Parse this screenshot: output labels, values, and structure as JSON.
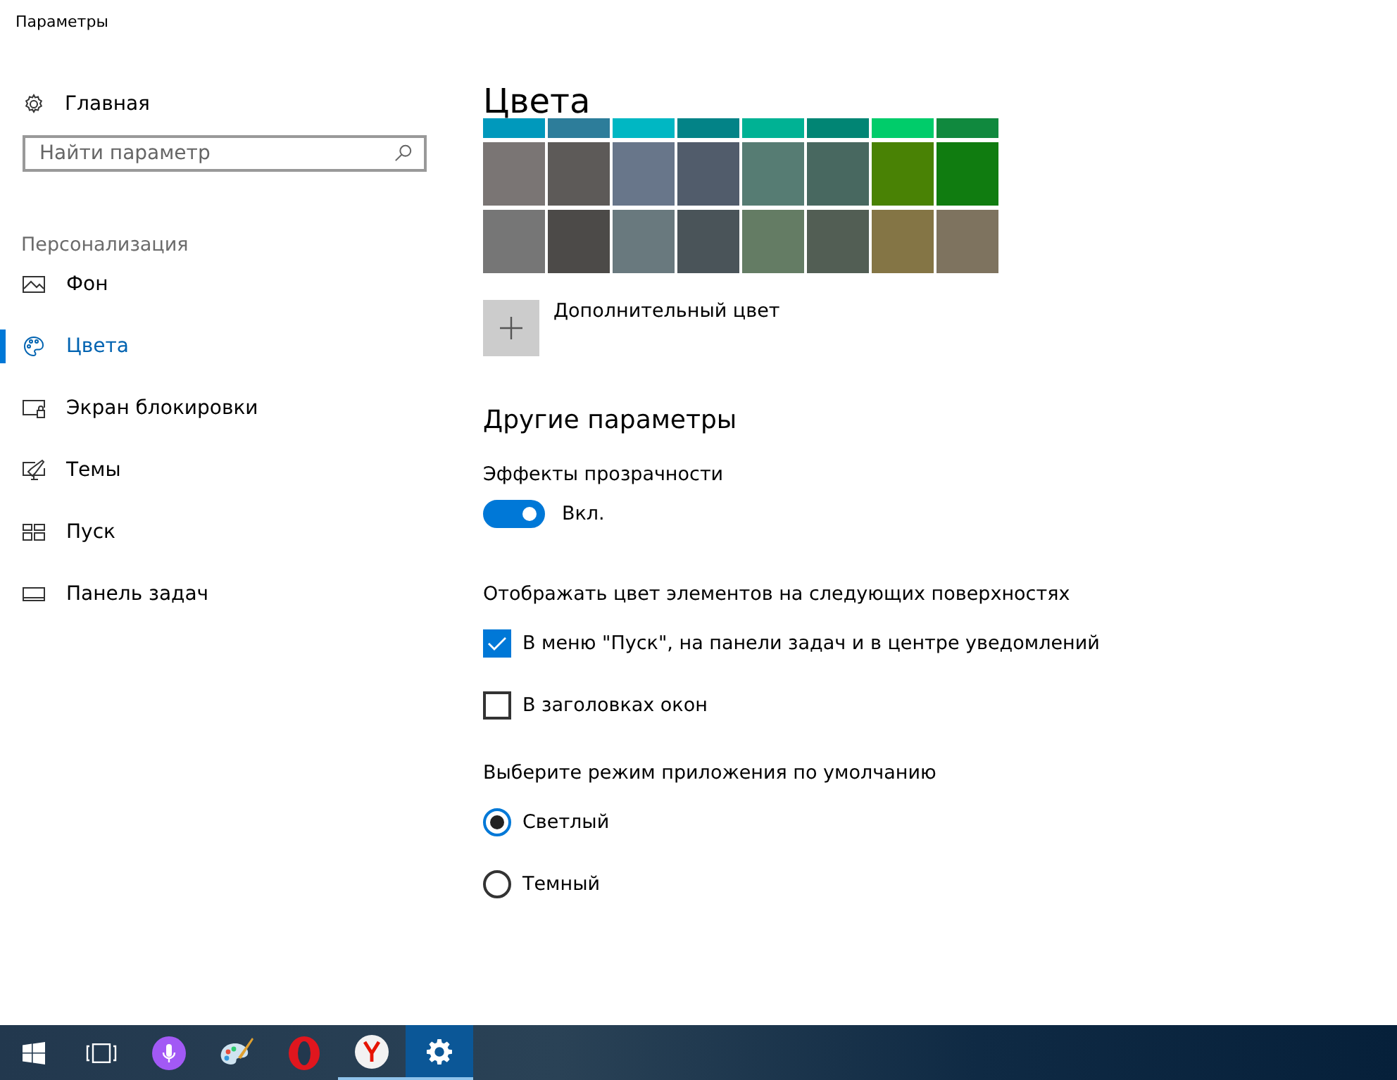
{
  "window": {
    "title": "Параметры"
  },
  "sidebar": {
    "home": "Главная",
    "search": {
      "placeholder": "Найти параметр"
    },
    "section": "Персонализация",
    "items": [
      {
        "label": "Фон",
        "kind": "picture",
        "selected": false
      },
      {
        "label": "Цвета",
        "kind": "palette",
        "selected": true
      },
      {
        "label": "Экран блокировки",
        "kind": "lock",
        "selected": false
      },
      {
        "label": "Темы",
        "kind": "themes",
        "selected": false
      },
      {
        "label": "Пуск",
        "kind": "start",
        "selected": false
      },
      {
        "label": "Панель задач",
        "kind": "taskbar",
        "selected": false
      }
    ]
  },
  "main": {
    "title": "Цвета",
    "partial_row": [
      {
        "color": "#0099bc"
      },
      {
        "color": "#2d7d9a"
      },
      {
        "color": "#00b7c3"
      },
      {
        "color": "#038387"
      },
      {
        "color": "#00b294"
      },
      {
        "color": "#018574"
      },
      {
        "color": "#00cc6a"
      },
      {
        "color": "#10893e"
      }
    ],
    "swatch_rows": [
      [
        {
          "color": "#7a7574"
        },
        {
          "color": "#5d5a58"
        },
        {
          "color": "#68768a"
        },
        {
          "color": "#515c6b"
        },
        {
          "color": "#567c73"
        },
        {
          "color": "#486860"
        },
        {
          "color": "#498205"
        },
        {
          "color": "#107c10"
        }
      ],
      [
        {
          "color": "#767676"
        },
        {
          "color": "#4c4a48"
        },
        {
          "color": "#69797e"
        },
        {
          "color": "#4a5459"
        },
        {
          "color": "#647c64"
        },
        {
          "color": "#525e54"
        },
        {
          "color": "#847545"
        },
        {
          "color": "#7e735f"
        }
      ]
    ],
    "custom_color": "Дополнительный цвет",
    "other_heading": "Другие параметры",
    "transparency": {
      "label": "Эффекты прозрачности",
      "on": true,
      "state_text": "Вкл."
    },
    "surfaces": {
      "label": "Отображать цвет элементов на следующих поверхностях",
      "options": [
        {
          "label": "В меню \"Пуск\", на панели задач и в центре уведомлений",
          "checked": true
        },
        {
          "label": "В заголовках окон",
          "checked": false
        }
      ]
    },
    "mode": {
      "label": "Выберите режим приложения по умолчанию",
      "options": [
        {
          "label": "Светлый",
          "selected": true
        },
        {
          "label": "Темный",
          "selected": false
        }
      ]
    }
  },
  "taskbar": {
    "items": [
      {
        "kind": "start",
        "selected": false,
        "running": false
      },
      {
        "kind": "taskview",
        "selected": false,
        "running": false
      },
      {
        "kind": "cortana",
        "selected": false,
        "running": false
      },
      {
        "kind": "paint",
        "selected": false,
        "running": false
      },
      {
        "kind": "opera",
        "selected": false,
        "running": false
      },
      {
        "kind": "yandex",
        "selected": false,
        "running": true
      },
      {
        "kind": "settings",
        "selected": true,
        "running": true
      }
    ]
  }
}
